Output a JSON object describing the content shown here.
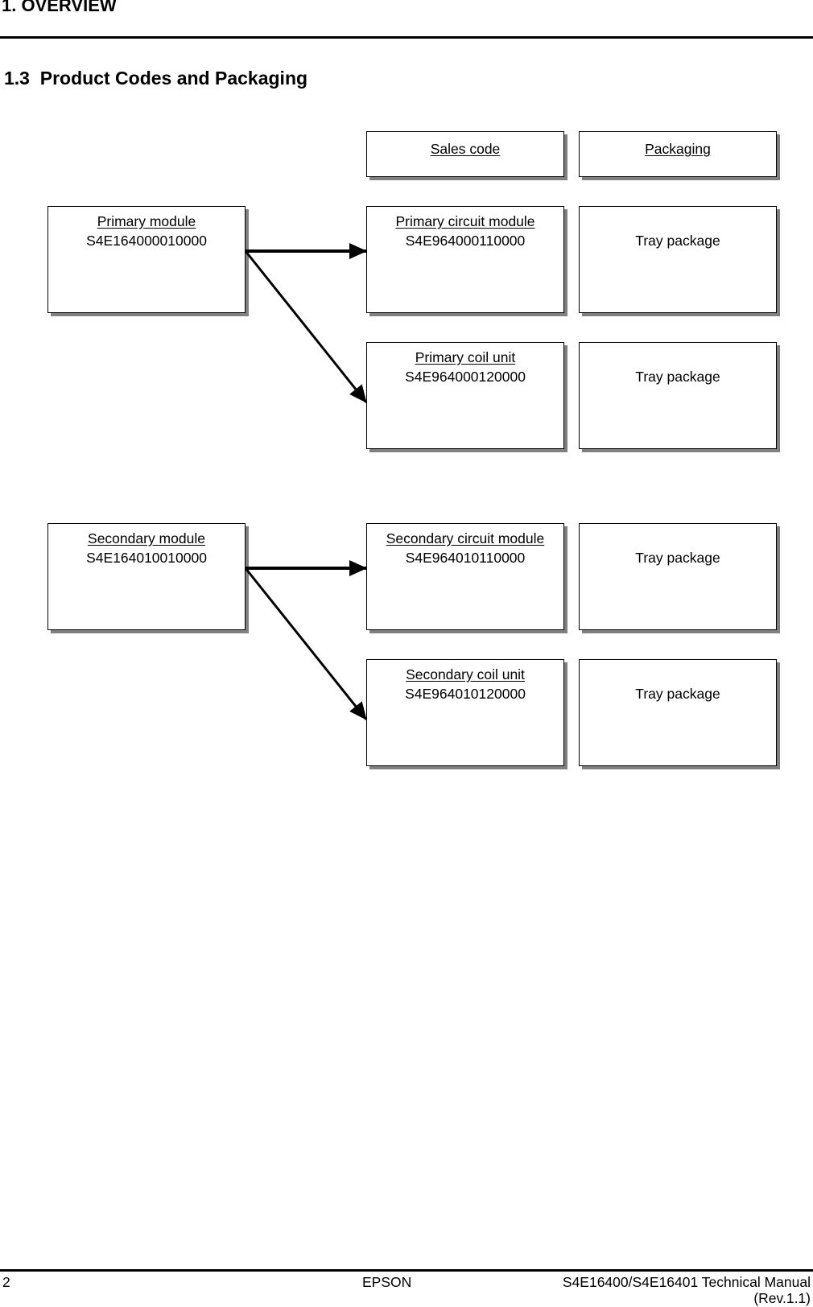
{
  "chapter": {
    "title": "1. OVERVIEW"
  },
  "section": {
    "title": "1.3  Product Codes and Packaging"
  },
  "headers": {
    "sales_code": "Sales code",
    "packaging": "Packaging"
  },
  "modules": [
    {
      "name": "Primary module",
      "code": "S4E164000010000",
      "children": [
        {
          "name": "Primary circuit module",
          "code": "S4E964000110000",
          "packaging": "Tray package"
        },
        {
          "name": "Primary coil unit",
          "code": "S4E964000120000",
          "packaging": "Tray package"
        }
      ]
    },
    {
      "name": "Secondary module",
      "code": "S4E164010010000",
      "children": [
        {
          "name": "Secondary circuit module",
          "code": "S4E964010110000",
          "packaging": "Tray package"
        },
        {
          "name": "Secondary coil unit",
          "code": "S4E964010120000",
          "packaging": "Tray package"
        }
      ]
    }
  ],
  "footer": {
    "page_number": "2",
    "brand": "EPSON",
    "manual_title": "S4E16400/S4E16401 Technical Manual",
    "revision": "(Rev.1.1)"
  }
}
